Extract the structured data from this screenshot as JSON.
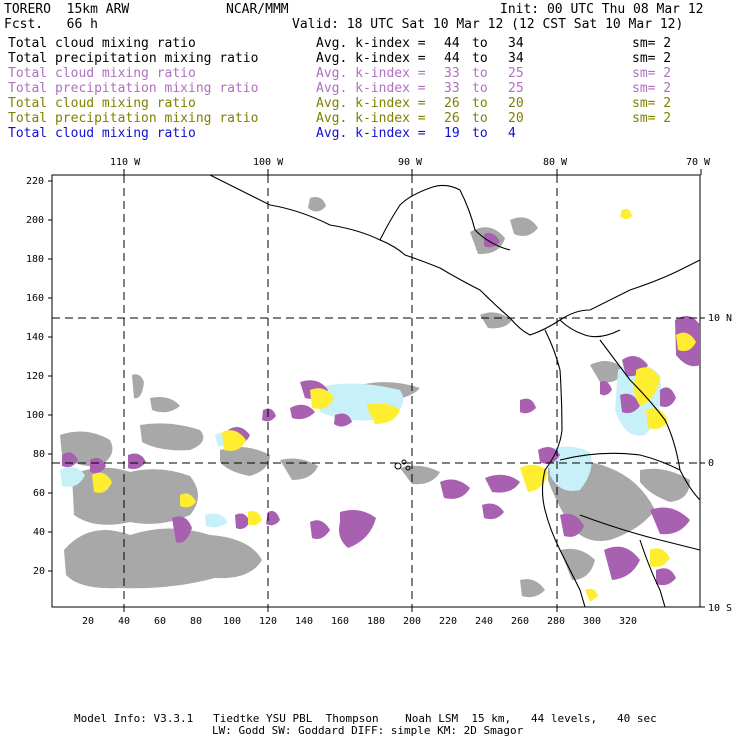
{
  "header": {
    "model": "TORERO  15km ARW",
    "org": "NCAR/MMM",
    "init": "Init: 00 UTC Thu 08 Mar 12",
    "fcst": "Fcst.   66 h",
    "valid": "Valid: 18 UTC Sat 10 Mar 12 (12 CST Sat 10 Mar 12)"
  },
  "fields": [
    {
      "name": "Total cloud mixing ratio",
      "kindex_label": "Avg. k-index =",
      "from": "44",
      "to_label": "to",
      "to": "34",
      "sm": "sm= 2",
      "color": "#000000"
    },
    {
      "name": "Total precipitation mixing ratio",
      "kindex_label": "Avg. k-index =",
      "from": "44",
      "to_label": "to",
      "to": "34",
      "sm": "sm= 2",
      "color": "#000000"
    },
    {
      "name": "Total cloud mixing ratio",
      "kindex_label": "Avg. k-index =",
      "from": "33",
      "to_label": "to",
      "to": "25",
      "sm": "sm= 2",
      "color": "#b070c0"
    },
    {
      "name": "Total precipitation mixing ratio",
      "kindex_label": "Avg. k-index =",
      "from": "33",
      "to_label": "to",
      "to": "25",
      "sm": "sm= 2",
      "color": "#b070c0"
    },
    {
      "name": "Total cloud mixing ratio",
      "kindex_label": "Avg. k-index =",
      "from": "26",
      "to_label": "to",
      "to": "20",
      "sm": "sm= 2",
      "color": "#808000"
    },
    {
      "name": "Total precipitation mixing ratio",
      "kindex_label": "Avg. k-index =",
      "from": "26",
      "to_label": "to",
      "to": "20",
      "sm": "sm= 2",
      "color": "#808000"
    },
    {
      "name": "Total cloud mixing ratio",
      "kindex_label": "Avg. k-index =",
      "from": "19",
      "to_label": "to",
      "to": "4",
      "sm": "",
      "color": "#1010d0"
    }
  ],
  "map": {
    "lon_labels": [
      "110 W",
      "100 W",
      "90 W",
      "80 W",
      "70 W"
    ],
    "lat_labels": [
      "10 N",
      "0",
      "10 S"
    ],
    "y_ticks": [
      "220",
      "200",
      "180",
      "160",
      "140",
      "120",
      "100",
      "80",
      "60",
      "40",
      "20"
    ],
    "x_ticks": [
      "20",
      "40",
      "60",
      "80",
      "100",
      "120",
      "140",
      "160",
      "180",
      "200",
      "220",
      "240",
      "260",
      "280",
      "300",
      "320"
    ],
    "colors": {
      "gray": "#a8a8a8",
      "purple": "#a860b0",
      "yellow": "#ffee30",
      "cyan": "#c8f0f8",
      "coast": "#000000"
    }
  },
  "footer": {
    "line1": "Model Info: V3.3.1   Tiedtke YSU PBL  Thompson    Noah LSM  15 km,   44 levels,   40 sec",
    "line2": "LW: Godd SW: Goddard DIFF: simple KM: 2D Smagor"
  }
}
